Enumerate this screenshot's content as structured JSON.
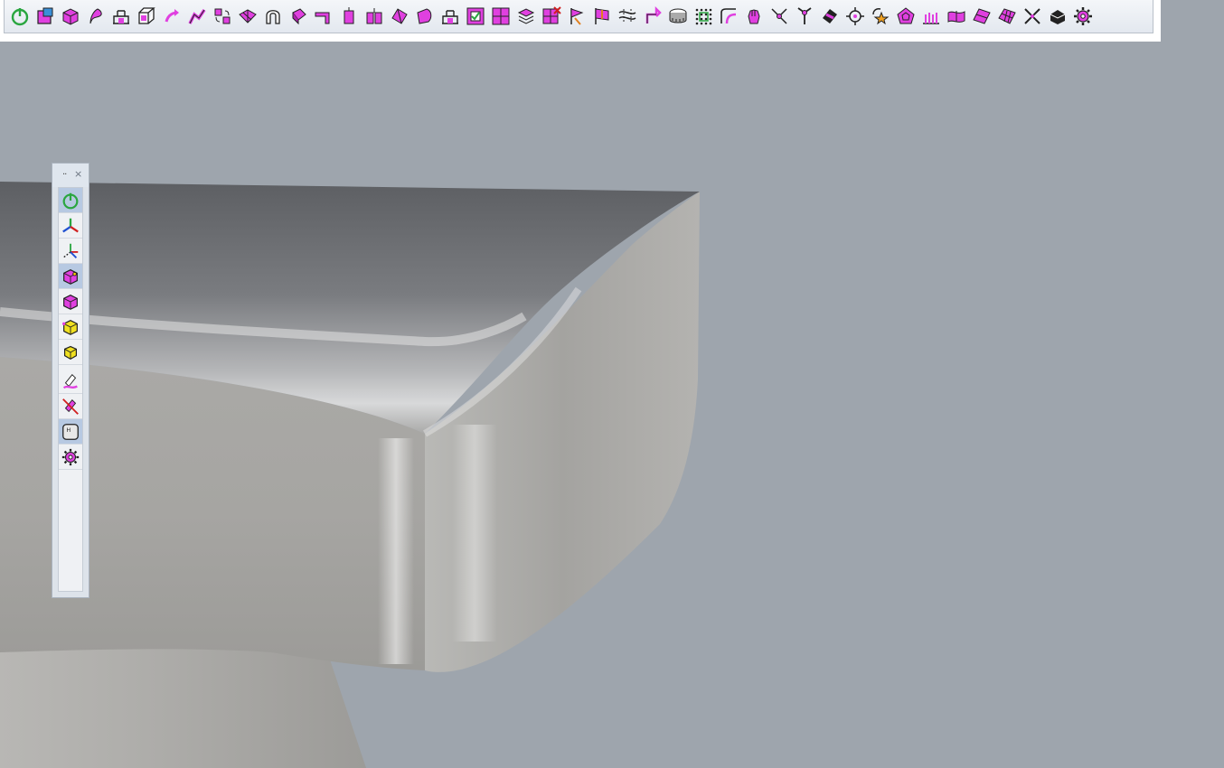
{
  "toolbar": {
    "buttons": [
      "power-icon",
      "box-face-icon",
      "sphere-icon",
      "branch-icon",
      "bridge-icon",
      "cube-outline-icon",
      "arrow-curve-icon",
      "arm-icon",
      "swap-icon",
      "split-face-icon",
      "arch-icon",
      "extrude-icon",
      "bend-icon",
      "column-icon",
      "column-double-icon",
      "wedge-icon",
      "roll-icon",
      "bridge-icon",
      "checkbox-face-icon",
      "grid-face-icon",
      "stack-icon",
      "delete-grid-icon",
      "flag-icon",
      "flag-split-icon",
      "weave-icon",
      "fold-icon",
      "ring-icon",
      "dot-grid-icon",
      "corner-icon",
      "hand-icon",
      "scissor-icon",
      "tree-icon",
      "diamond-icon",
      "target-icon",
      "star-rotate-icon",
      "pentagon-icon",
      "comb-icon",
      "surface-icon",
      "surface-tilt-icon",
      "lattice-icon",
      "cross-icon",
      "solid-icon",
      "gear-icon"
    ]
  },
  "palette": {
    "grip": "··",
    "close": "×",
    "buttons": [
      {
        "icon": "power-icon",
        "active": true
      },
      {
        "icon": "axis-icon",
        "active": false
      },
      {
        "icon": "transform-axis-icon",
        "active": false
      },
      {
        "icon": "cube-pink-active-icon",
        "active": true
      },
      {
        "icon": "cube-pink-icon",
        "active": false
      },
      {
        "icon": "cube-yellow-icon",
        "active": false
      },
      {
        "icon": "cube-yellow-small-icon",
        "active": false
      },
      {
        "icon": "paint-icon",
        "active": false
      },
      {
        "icon": "paint-clear-icon",
        "active": false
      },
      {
        "icon": "hotkey-icon",
        "active": true
      },
      {
        "icon": "gear-icon",
        "active": false
      }
    ]
  },
  "colors": {
    "background": "#9ea5ad",
    "model": "#a7a6a3",
    "accent_pink": "#e040e0",
    "accent_green": "#2aa640"
  }
}
